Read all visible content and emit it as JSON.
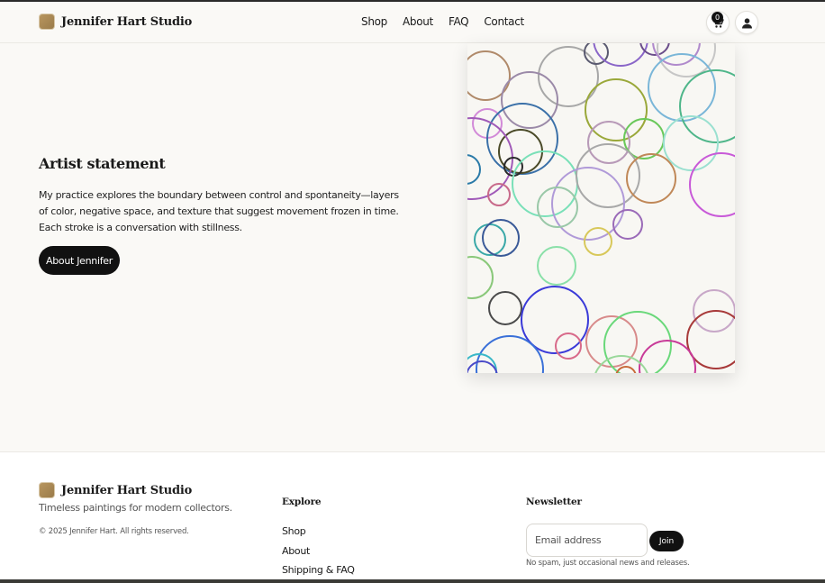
{
  "header": {
    "brand": "Jennifer Hart Studio",
    "nav": [
      "Shop",
      "About",
      "FAQ",
      "Contact"
    ],
    "cart_count": "0"
  },
  "hero": {
    "title": "Artist statement",
    "body": "My practice explores the boundary between control and spontaneity—layers of color, negative space, and texture that suggest movement frozen in time. Each stroke is a conversation with stillness.",
    "button": "About Jennifer"
  },
  "footer": {
    "brand": "Jennifer Hart Studio",
    "tagline": "Timeless paintings for modern collectors.",
    "copyright": "© 2025 Jennifer Hart. All rights reserved.",
    "explore_title": "Explore",
    "explore_links": [
      "Shop",
      "About",
      "Shipping & FAQ"
    ],
    "newsletter_title": "Newsletter",
    "email_placeholder": "Email address",
    "join_label": "Join",
    "note": "No spam, just occasional news and releases."
  },
  "colors": {
    "background": "#faf9f6",
    "primary_button": "#111111",
    "brand_mark": "#b8965f"
  },
  "icons": {
    "cart": "cart-icon",
    "account": "user-icon"
  }
}
